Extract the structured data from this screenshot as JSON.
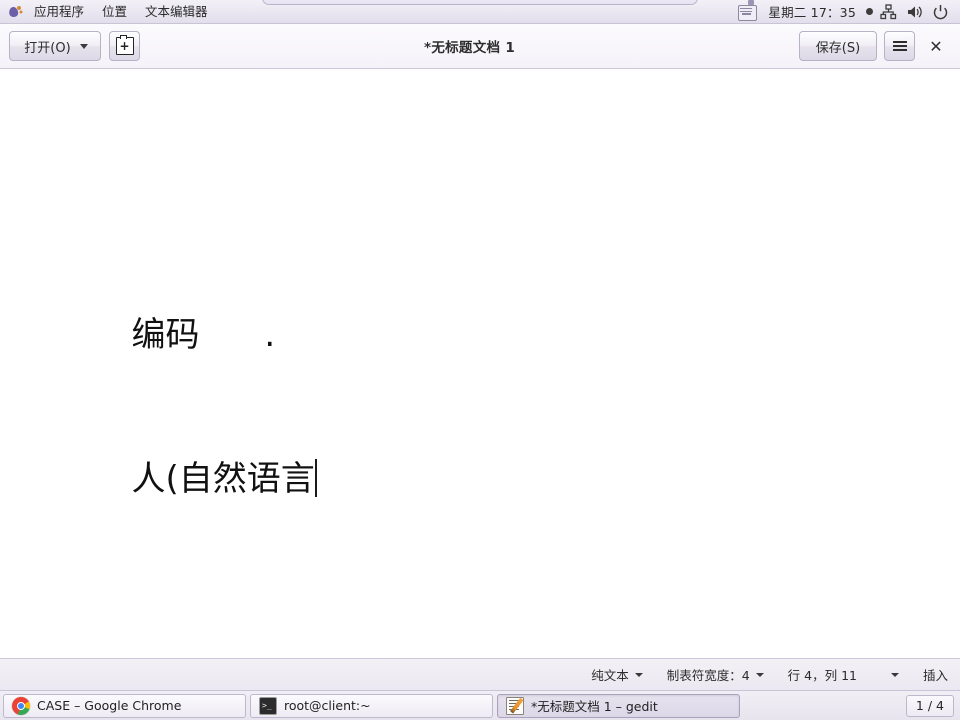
{
  "top_panel": {
    "logo_icon": "gnome-foot-icon",
    "menus": [
      {
        "label": "应用程序"
      },
      {
        "label": "位置"
      },
      {
        "label": "文本编辑器"
      }
    ],
    "keyboard_icon": "keyboard-indicator-icon",
    "clock": "星期二 17：35",
    "status_dot": "recording-dot-icon",
    "network_icon": "network-icon",
    "volume_icon": "volume-icon",
    "power_icon": "power-icon"
  },
  "titlebar": {
    "open_label": "打开(O)",
    "open_caret": "chevron-down-icon",
    "new_doc_icon": "new-document-icon",
    "title": "*无标题文档 1",
    "save_label": "保存(S)",
    "menu_icon": "hamburger-menu-icon",
    "close_icon": "close-icon"
  },
  "document": {
    "line1": "编码      .",
    "line2": "人(自然语言"
  },
  "statusbar": {
    "language": "纯文本",
    "language_caret": "chevron-down-icon",
    "tab_width": "制表符宽度：4",
    "tab_caret": "chevron-down-icon",
    "position": "行 4，列 11",
    "position_caret": "chevron-down-icon",
    "insert_mode": "插入"
  },
  "taskbar": {
    "items": [
      {
        "label": "CASE – Google Chrome",
        "icon": "chrome-icon",
        "active": false
      },
      {
        "label": "root@client:~",
        "icon": "terminal-icon",
        "active": false
      },
      {
        "label": "*无标题文档 1 – gedit",
        "icon": "gedit-icon",
        "active": true
      }
    ],
    "workspace": "1 / 4"
  },
  "colors": {
    "panel_bg": "#e9e6f1",
    "titlebar_bg": "#f7f5fa",
    "doc_bg": "#ffffff",
    "text": "#111111",
    "accent": "#6b5fa8"
  }
}
